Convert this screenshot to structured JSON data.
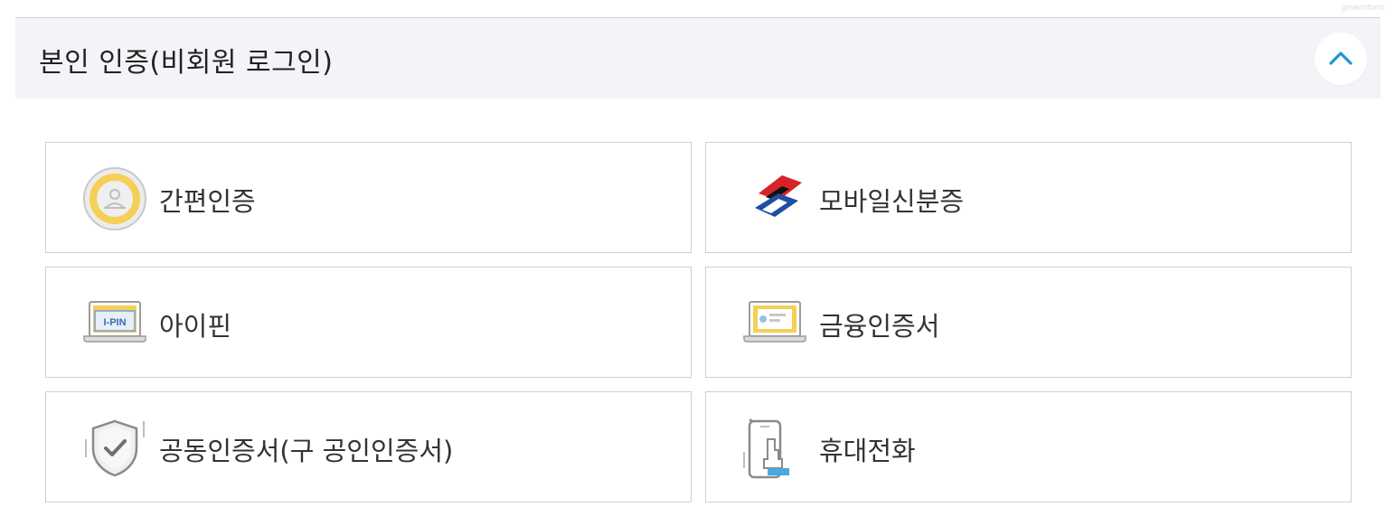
{
  "watermark": "goverinform",
  "header": {
    "title": "본인 인증(비회원 로그인)"
  },
  "options": [
    {
      "label": "간편인증",
      "icon": "simple-auth-icon"
    },
    {
      "label": "모바일신분증",
      "icon": "mobile-id-icon"
    },
    {
      "label": "아이핀",
      "icon": "ipin-icon",
      "icon_text": "I-PIN"
    },
    {
      "label": "금융인증서",
      "icon": "financial-certificate-icon"
    },
    {
      "label": "공동인증서(구 공인인증서)",
      "icon": "joint-certificate-shield-icon"
    },
    {
      "label": "휴대전화",
      "icon": "mobile-phone-icon"
    }
  ],
  "colors": {
    "header_bg": "#f3f4f8",
    "accent_blue": "#1e95d3",
    "icon_yellow": "#f5cf57",
    "icon_red": "#d8232a",
    "icon_navy": "#1f4ea3",
    "border": "#cfcfcf"
  }
}
